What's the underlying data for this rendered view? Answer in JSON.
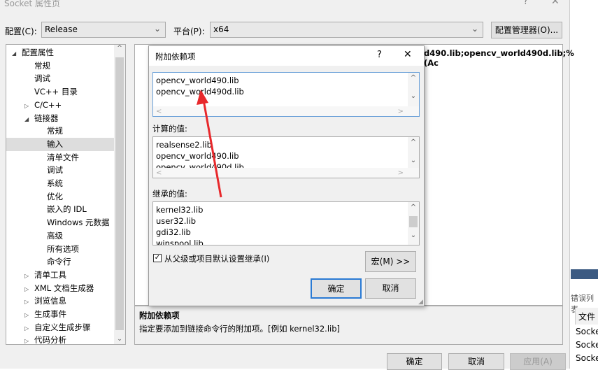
{
  "window": {
    "title": "Socket 属性页",
    "help": "?",
    "close": "✕"
  },
  "toolbar": {
    "config_label": "配置(C):",
    "config_value": "Release",
    "platform_label": "平台(P):",
    "platform_value": "x64",
    "config_manager": "配置管理器(O)..."
  },
  "tree": [
    {
      "label": "配置属性",
      "level": 0,
      "arrow": "◢"
    },
    {
      "label": "常规",
      "level": 1
    },
    {
      "label": "调试",
      "level": 1
    },
    {
      "label": "VC++ 目录",
      "level": 1
    },
    {
      "label": "C/C++",
      "level": 1,
      "arrow": "▷"
    },
    {
      "label": "链接器",
      "level": 1,
      "arrow": "◢"
    },
    {
      "label": "常规",
      "level": 2
    },
    {
      "label": "输入",
      "level": 2,
      "selected": true
    },
    {
      "label": "清单文件",
      "level": 2
    },
    {
      "label": "调试",
      "level": 2
    },
    {
      "label": "系统",
      "level": 2
    },
    {
      "label": "优化",
      "level": 2
    },
    {
      "label": "嵌入的 IDL",
      "level": 2
    },
    {
      "label": "Windows 元数据",
      "level": 2
    },
    {
      "label": "高级",
      "level": 2
    },
    {
      "label": "所有选项",
      "level": 2
    },
    {
      "label": "命令行",
      "level": 2
    },
    {
      "label": "清单工具",
      "level": 1,
      "arrow": "▷"
    },
    {
      "label": "XML 文档生成器",
      "level": 1,
      "arrow": "▷"
    },
    {
      "label": "浏览信息",
      "level": 1,
      "arrow": "▷"
    },
    {
      "label": "生成事件",
      "level": 1,
      "arrow": "▷"
    },
    {
      "label": "自定义生成步骤",
      "level": 1,
      "arrow": "▷"
    },
    {
      "label": "代码分析",
      "level": 1,
      "arrow": "▷"
    }
  ],
  "content": {
    "value_text": "d490.lib;opencv_world490d.lib;%(Ac"
  },
  "description": {
    "title": "附加依赖项",
    "text": "指定要添加到链接命令行的附加项。[例如 kernel32.lib]"
  },
  "bottom": {
    "ok": "确定",
    "cancel": "取消",
    "apply": "应用(A)"
  },
  "dialog": {
    "title": "附加依赖项",
    "help": "?",
    "close": "✕",
    "edit_lines": [
      "opencv_world490.lib",
      "opencv_world490d.lib"
    ],
    "computed_label": "计算的值:",
    "computed_lines": [
      "realsense2.lib",
      "opencv_world490.lib",
      "opencv_world490d.lib"
    ],
    "inherited_label": "继承的值:",
    "inherited_lines": [
      "kernel32.lib",
      "user32.lib",
      "gdi32.lib",
      "winspool.lib"
    ],
    "inherit_checkbox": "从父级或项目默认设置继承(I)",
    "inherit_checked": true,
    "macro": "宏(M) >>",
    "ok": "确定",
    "cancel": "取消"
  },
  "background_app": {
    "error_list": "错误列表",
    "file_header": "文件",
    "rows": [
      "Socke",
      "Socke",
      "Socke"
    ]
  },
  "colors": {
    "annotation_arrow": "#e8282b",
    "ok_border": "#2a7ad4"
  }
}
